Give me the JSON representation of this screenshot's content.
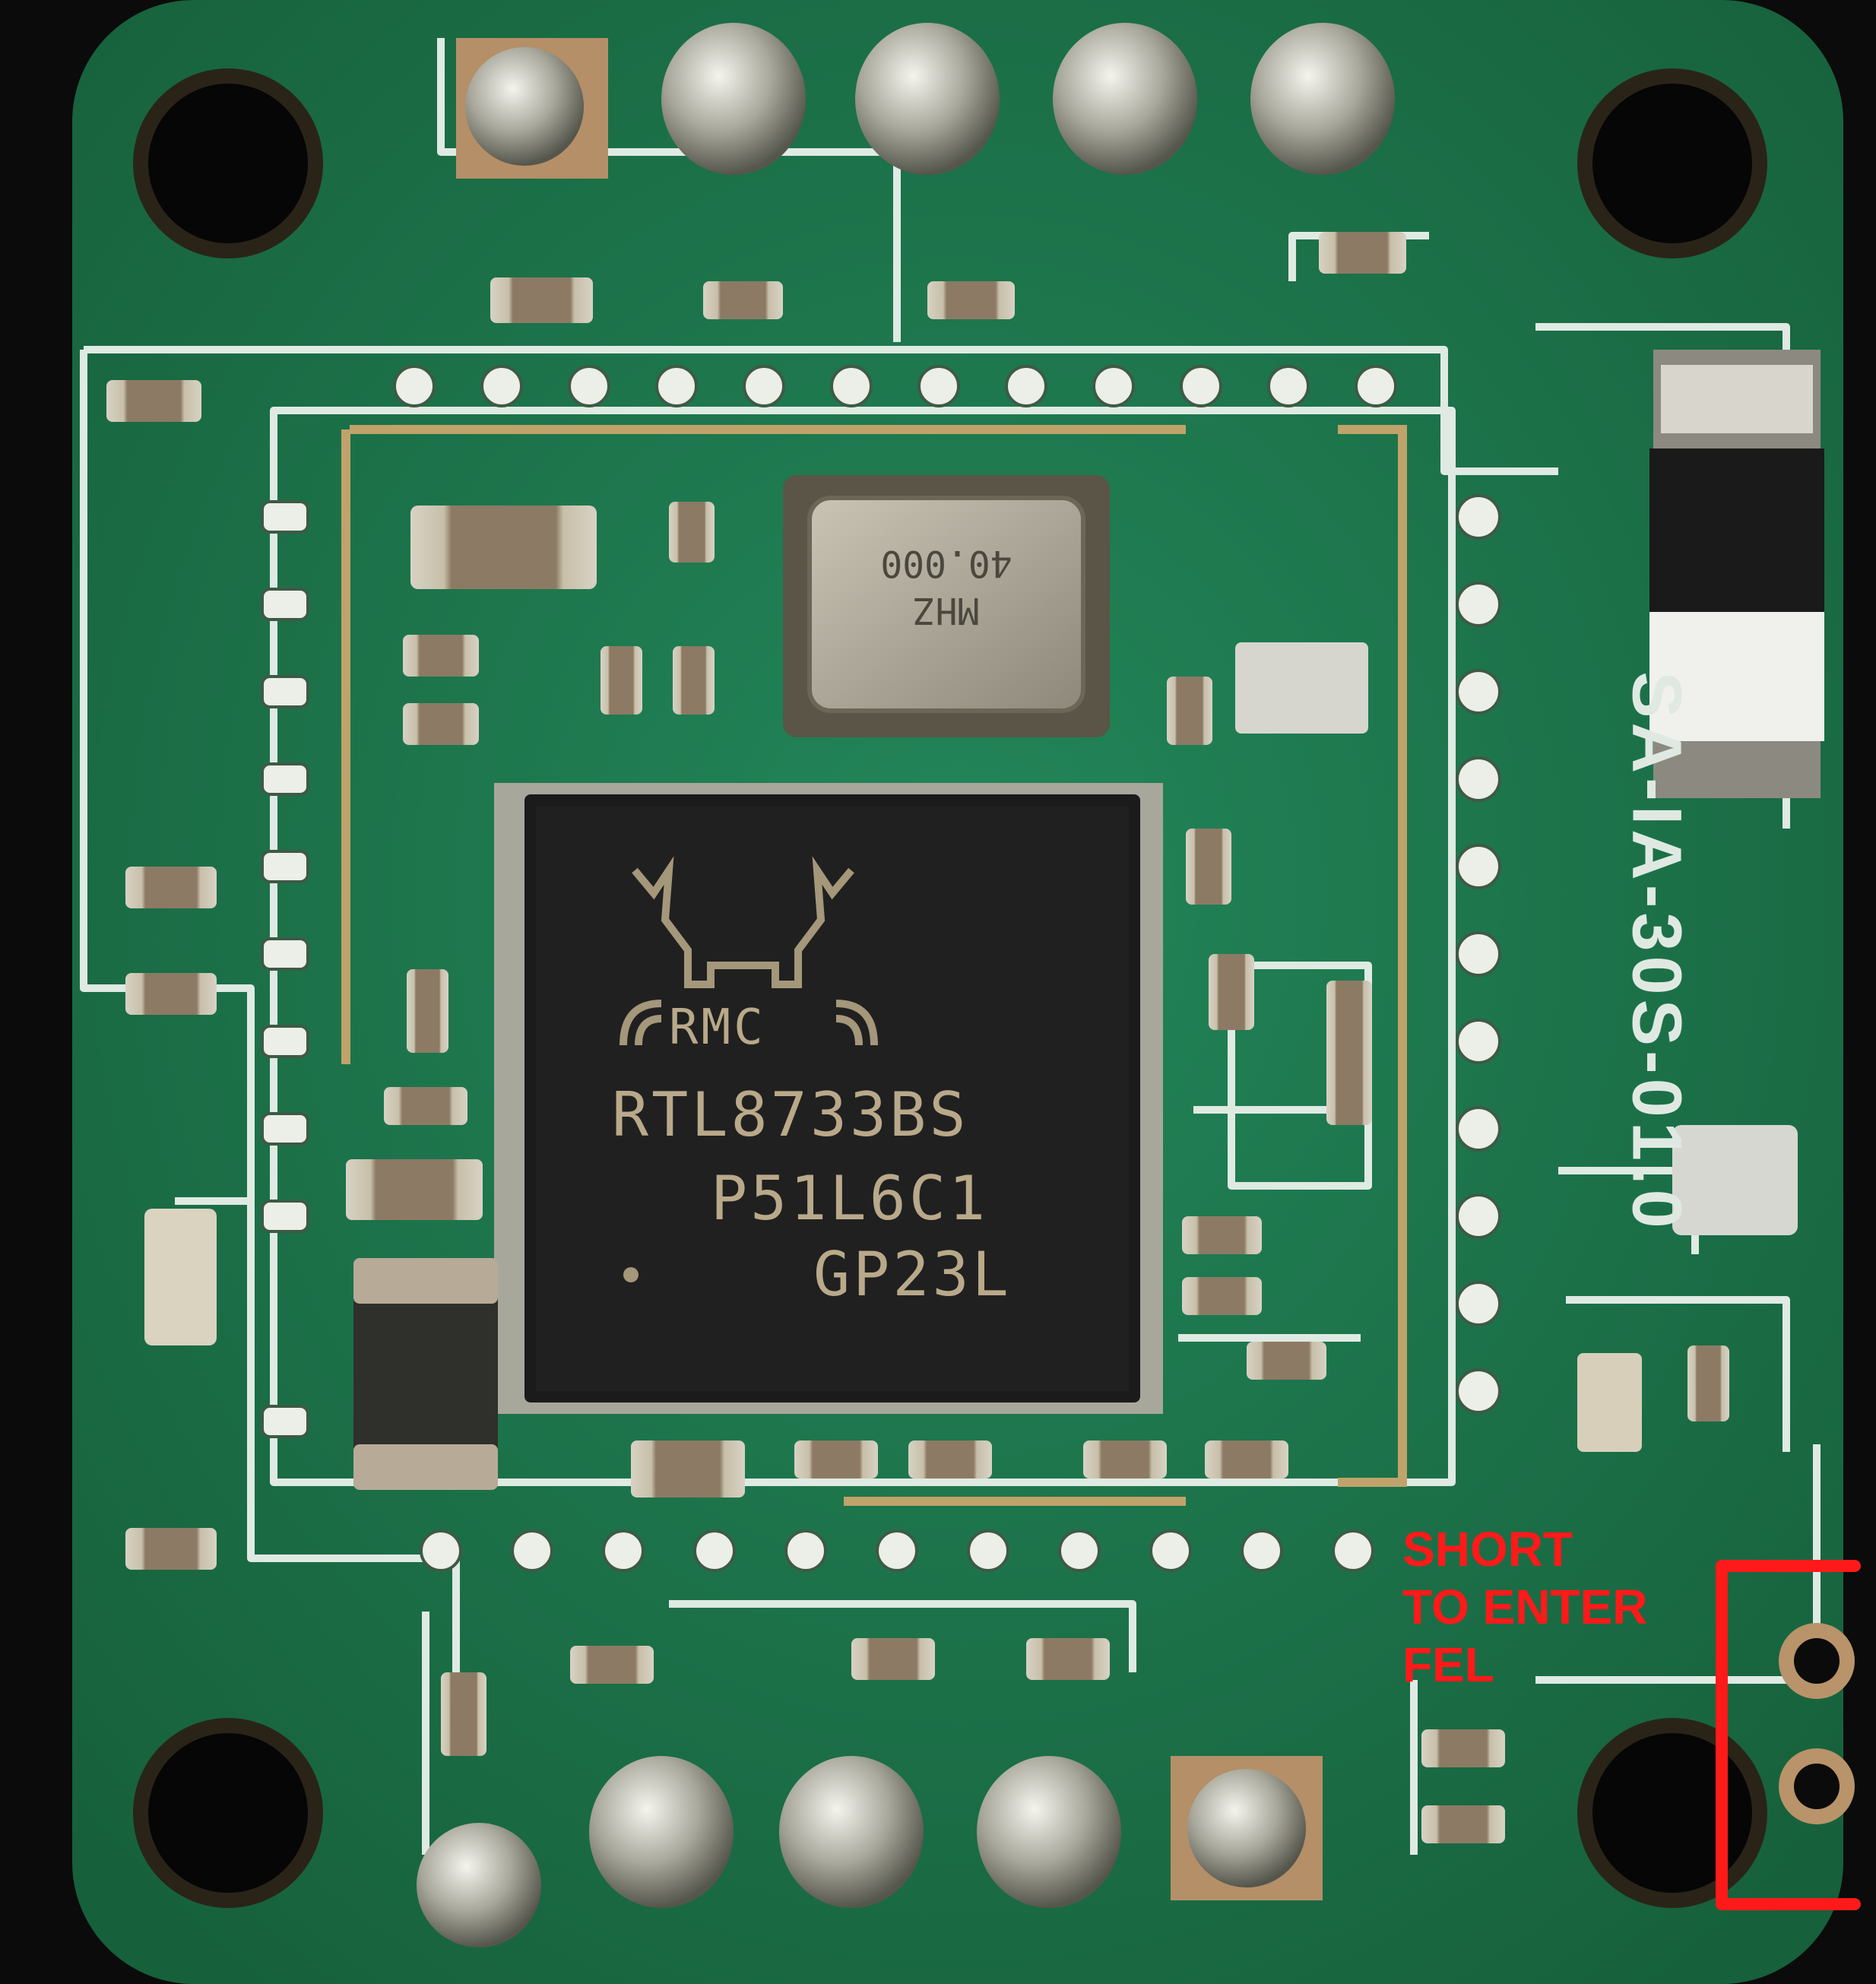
{
  "image": {
    "kind": "photo",
    "subject": "PCB"
  },
  "chip": {
    "logo": "RMC",
    "line1": "RTL8733BS",
    "line2": "P51L6C1",
    "line3": "GP23L"
  },
  "crystal": {
    "freq": "40.000",
    "unit": "MHZ"
  },
  "board_silk": {
    "model": "SA-IA-30S-01.0"
  },
  "annotation": {
    "line1": "SHORT",
    "line2": "TO ENTER",
    "line3": "FEL"
  },
  "colors": {
    "board": "#1f7a4c",
    "silkscreen": "#e4eee8",
    "chip": "#1b1b1b",
    "annotation": "#ff1a1a"
  }
}
